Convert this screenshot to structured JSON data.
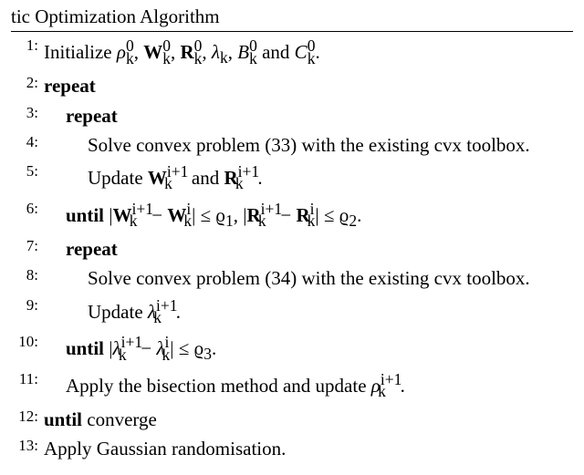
{
  "title_fragment": "tic Optimization Algorithm",
  "lines": {
    "l1_a": "Initialize ",
    "l1_b": "ρ",
    "l1_c": "0",
    "l1_d": "k",
    "l1_e": ", ",
    "l1_f": "W",
    "l1_g": "0",
    "l1_h": "k",
    "l1_i": ", ",
    "l1_j": "R",
    "l1_k": "0",
    "l1_l": "k",
    "l1_m": ", ",
    "l1_n": "λ",
    "l1_o": "k",
    "l1_p": ", ",
    "l1_q": "B",
    "l1_r": "0",
    "l1_s": "k",
    "l1_t": " and ",
    "l1_u": "C",
    "l1_v": "0",
    "l1_w": "k",
    "l1_x": ".",
    "l2": "repeat",
    "l3": "repeat",
    "l4": "Solve convex problem (33) with the existing cvx toolbox.",
    "l5_a": "Update ",
    "l5_b": "W",
    "l5_c": "i+1",
    "l5_d": "k",
    "l5_e": " and ",
    "l5_f": "R",
    "l5_g": "i+1",
    "l5_h": "k",
    "l5_i": ".",
    "l6_a": "until",
    "l6_b": "  |",
    "l6_c": "W",
    "l6_d": "i+1",
    "l6_e": "k",
    "l6_f": " − ",
    "l6_g": "W",
    "l6_h": "i",
    "l6_i": "k",
    "l6_j": "| ≤ ϱ",
    "l6_k": "1",
    "l6_l": ", |",
    "l6_m": "R",
    "l6_n": "i+1",
    "l6_o": "k",
    "l6_p": " − ",
    "l6_q": "R",
    "l6_r": "i",
    "l6_s": "k",
    "l6_t": "| ≤ ϱ",
    "l6_u": "2",
    "l6_v": ".",
    "l7": "repeat",
    "l8": "Solve convex problem (34) with the existing cvx toolbox.",
    "l9_a": "Update ",
    "l9_b": "λ",
    "l9_c": "i+1",
    "l9_d": "k",
    "l9_e": ".",
    "l10_a": "until",
    "l10_b": "   |",
    "l10_c": "λ",
    "l10_d": "i+1",
    "l10_e": "k",
    "l10_f": " − ",
    "l10_g": "λ",
    "l10_h": "i",
    "l10_i": "k",
    "l10_j": "| ≤ ϱ",
    "l10_k": "3",
    "l10_l": ".",
    "l11_a": "Apply the bisection method and update ",
    "l11_b": "ρ",
    "l11_c": "i+1",
    "l11_d": "k",
    "l11_e": ".",
    "l12_a": "until",
    "l12_b": " converge",
    "l13": "Apply Gaussian randomisation."
  }
}
